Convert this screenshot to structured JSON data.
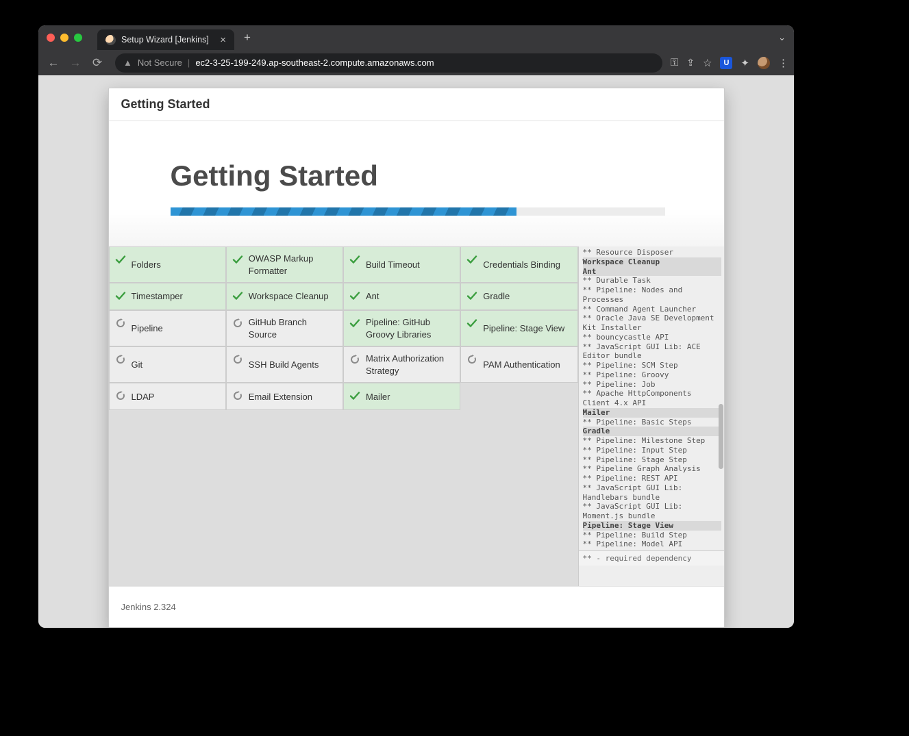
{
  "browser": {
    "tab_title": "Setup Wizard [Jenkins]",
    "not_secure_label": "Not Secure",
    "url_display": "ec2-3-25-199-249.ap-southeast-2.compute.amazonaws.com"
  },
  "modal": {
    "header_title": "Getting Started",
    "hero_title": "Getting Started",
    "progress_percent": 70,
    "footer_text": "Jenkins 2.324"
  },
  "plugins": [
    {
      "name": "Folders",
      "status": "done"
    },
    {
      "name": "OWASP Markup Formatter",
      "status": "done"
    },
    {
      "name": "Build Timeout",
      "status": "done"
    },
    {
      "name": "Credentials Binding",
      "status": "done"
    },
    {
      "name": "Timestamper",
      "status": "done"
    },
    {
      "name": "Workspace Cleanup",
      "status": "done"
    },
    {
      "name": "Ant",
      "status": "done"
    },
    {
      "name": "Gradle",
      "status": "done"
    },
    {
      "name": "Pipeline",
      "status": "pending"
    },
    {
      "name": "GitHub Branch Source",
      "status": "pending"
    },
    {
      "name": "Pipeline: GitHub Groovy Libraries",
      "status": "done"
    },
    {
      "name": "Pipeline: Stage View",
      "status": "done"
    },
    {
      "name": "Git",
      "status": "pending"
    },
    {
      "name": "SSH Build Agents",
      "status": "pending"
    },
    {
      "name": "Matrix Authorization Strategy",
      "status": "pending"
    },
    {
      "name": "PAM Authentication",
      "status": "pending"
    },
    {
      "name": "LDAP",
      "status": "pending"
    },
    {
      "name": "Email Extension",
      "status": "pending"
    },
    {
      "name": "Mailer",
      "status": "done"
    }
  ],
  "log": {
    "footer_note": "** - required dependency",
    "lines": [
      {
        "t": "** Resource Disposer",
        "hl": false
      },
      {
        "t": "Workspace Cleanup",
        "hl": true
      },
      {
        "t": "Ant",
        "hl": true
      },
      {
        "t": "** Durable Task",
        "hl": false
      },
      {
        "t": "** Pipeline: Nodes and Processes",
        "hl": false
      },
      {
        "t": "** Command Agent Launcher",
        "hl": false
      },
      {
        "t": "** Oracle Java SE Development Kit Installer",
        "hl": false
      },
      {
        "t": "** bouncycastle API",
        "hl": false
      },
      {
        "t": "** JavaScript GUI Lib: ACE Editor bundle",
        "hl": false
      },
      {
        "t": "** Pipeline: SCM Step",
        "hl": false
      },
      {
        "t": "** Pipeline: Groovy",
        "hl": false
      },
      {
        "t": "** Pipeline: Job",
        "hl": false
      },
      {
        "t": "** Apache HttpComponents Client 4.x API",
        "hl": false
      },
      {
        "t": "Mailer",
        "hl": true
      },
      {
        "t": "** Pipeline: Basic Steps",
        "hl": false
      },
      {
        "t": "Gradle",
        "hl": true
      },
      {
        "t": "** Pipeline: Milestone Step",
        "hl": false
      },
      {
        "t": "** Pipeline: Input Step",
        "hl": false
      },
      {
        "t": "** Pipeline: Stage Step",
        "hl": false
      },
      {
        "t": "** Pipeline Graph Analysis",
        "hl": false
      },
      {
        "t": "** Pipeline: REST API",
        "hl": false
      },
      {
        "t": "** JavaScript GUI Lib: Handlebars bundle",
        "hl": false
      },
      {
        "t": "** JavaScript GUI Lib: Moment.js bundle",
        "hl": false
      },
      {
        "t": "Pipeline: Stage View",
        "hl": true
      },
      {
        "t": "** Pipeline: Build Step",
        "hl": false
      },
      {
        "t": "** Pipeline: Model API",
        "hl": false
      }
    ]
  }
}
